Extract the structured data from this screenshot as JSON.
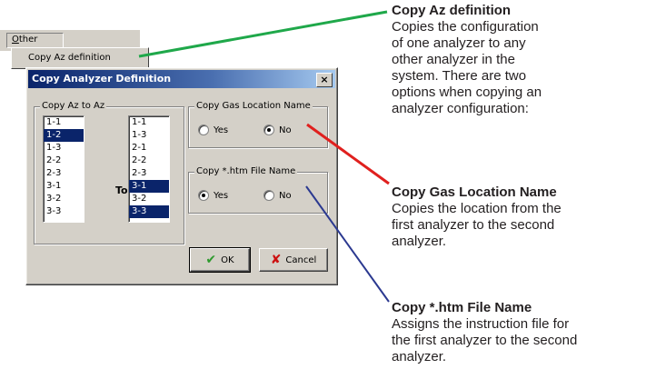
{
  "menu": {
    "other_label_u": "O",
    "other_label_rest": "ther",
    "copy_az_item": "Copy Az definition"
  },
  "dialog": {
    "title": "Copy Analyzer Definition",
    "close_glyph": "×",
    "from_group_label": "Copy Az to Az",
    "from_list": [
      {
        "label": "1-1",
        "selected": false
      },
      {
        "label": "1-2",
        "selected": true
      },
      {
        "label": "1-3",
        "selected": false
      },
      {
        "label": "2-2",
        "selected": false
      },
      {
        "label": "2-3",
        "selected": false
      },
      {
        "label": "3-1",
        "selected": false
      },
      {
        "label": "3-2",
        "selected": false
      },
      {
        "label": "3-3",
        "selected": false
      }
    ],
    "to_label": "To -",
    "to_list": [
      {
        "label": "1-1",
        "selected": false
      },
      {
        "label": "1-3",
        "selected": false
      },
      {
        "label": "2-1",
        "selected": false
      },
      {
        "label": "2-2",
        "selected": false
      },
      {
        "label": "2-3",
        "selected": false
      },
      {
        "label": "3-1",
        "selected": true
      },
      {
        "label": "3-2",
        "selected": false
      },
      {
        "label": "3-3",
        "selected": true
      }
    ],
    "gas_group_label": "Copy Gas Location Name",
    "gas_yes": "Yes",
    "gas_no": "No",
    "gas_selected": "No",
    "htm_group_label": "Copy *.htm File Name",
    "htm_yes": "Yes",
    "htm_no": "No",
    "htm_selected": "Yes",
    "ok_label": "OK",
    "cancel_label": "Cancel"
  },
  "annotations": [
    {
      "heading": "Copy Az definition",
      "lines": [
        "Copies the configuration",
        "of one analyzer to any",
        "other analyzer in the",
        "system. There are two",
        "options when copying an",
        "analyzer configuration:"
      ],
      "color": "#1fa84a"
    },
    {
      "heading": "Copy Gas Location Name",
      "lines": [
        "Copies the location from the",
        "first analyzer to the second",
        "analyzer."
      ],
      "color": "#e0201e"
    },
    {
      "heading": "Copy *.htm File Name",
      "lines": [
        "Assigns the instruction file for",
        "the first analyzer to the second",
        "analyzer."
      ],
      "color": "#2b3990"
    }
  ]
}
